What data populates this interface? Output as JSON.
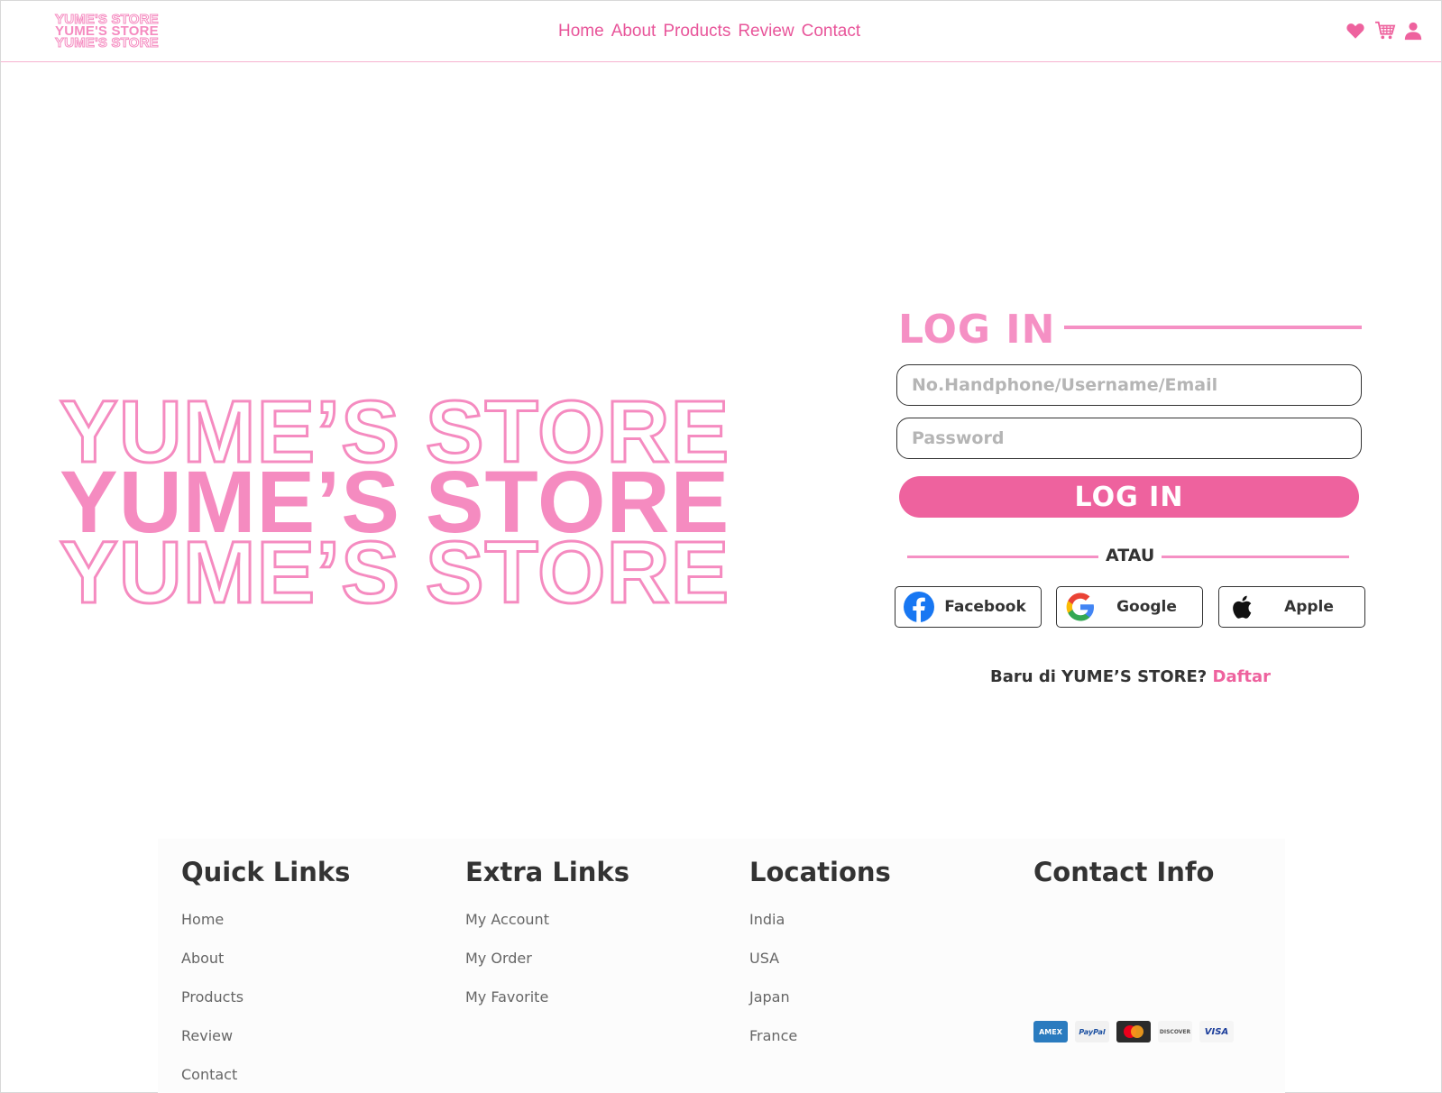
{
  "header": {
    "logo_lines": [
      "YUME'S STORE",
      "YUME'S STORE",
      "YUME'S STORE"
    ],
    "nav": [
      "Home",
      "About",
      "Products",
      "Review",
      "Contact"
    ],
    "icons": [
      "heart-icon",
      "cart-icon",
      "user-icon"
    ]
  },
  "hero": {
    "lines": [
      "YUME’S STORE",
      "YUME’S STORE",
      "YUME’S STORE"
    ]
  },
  "login": {
    "title": "LOG IN",
    "username_placeholder": "No.Handphone/Username/Email",
    "password_placeholder": "Password",
    "button": "LOG IN",
    "divider": "ATAU",
    "social": {
      "facebook": "Facebook",
      "google": "Google",
      "apple": "Apple"
    },
    "signup_prompt": "Baru di YUME’S STORE?",
    "signup_link": "Daftar"
  },
  "footer": {
    "quick_links": {
      "title": "Quick Links",
      "items": [
        "Home",
        "About",
        "Products",
        "Review",
        "Contact"
      ]
    },
    "extra_links": {
      "title": "Extra Links",
      "items": [
        "My Account",
        "My Order",
        "My Favorite"
      ]
    },
    "locations": {
      "title": "Locations",
      "items": [
        "India",
        "USA",
        "Japan",
        "France"
      ]
    },
    "contact": {
      "title": "Contact Info"
    },
    "payments": [
      "AMEX",
      "PayPal",
      "MC",
      "DISCOVER",
      "VISA"
    ]
  },
  "colors": {
    "accent": "#ee629e",
    "accent_light": "#f590c4",
    "text": "#333333"
  }
}
